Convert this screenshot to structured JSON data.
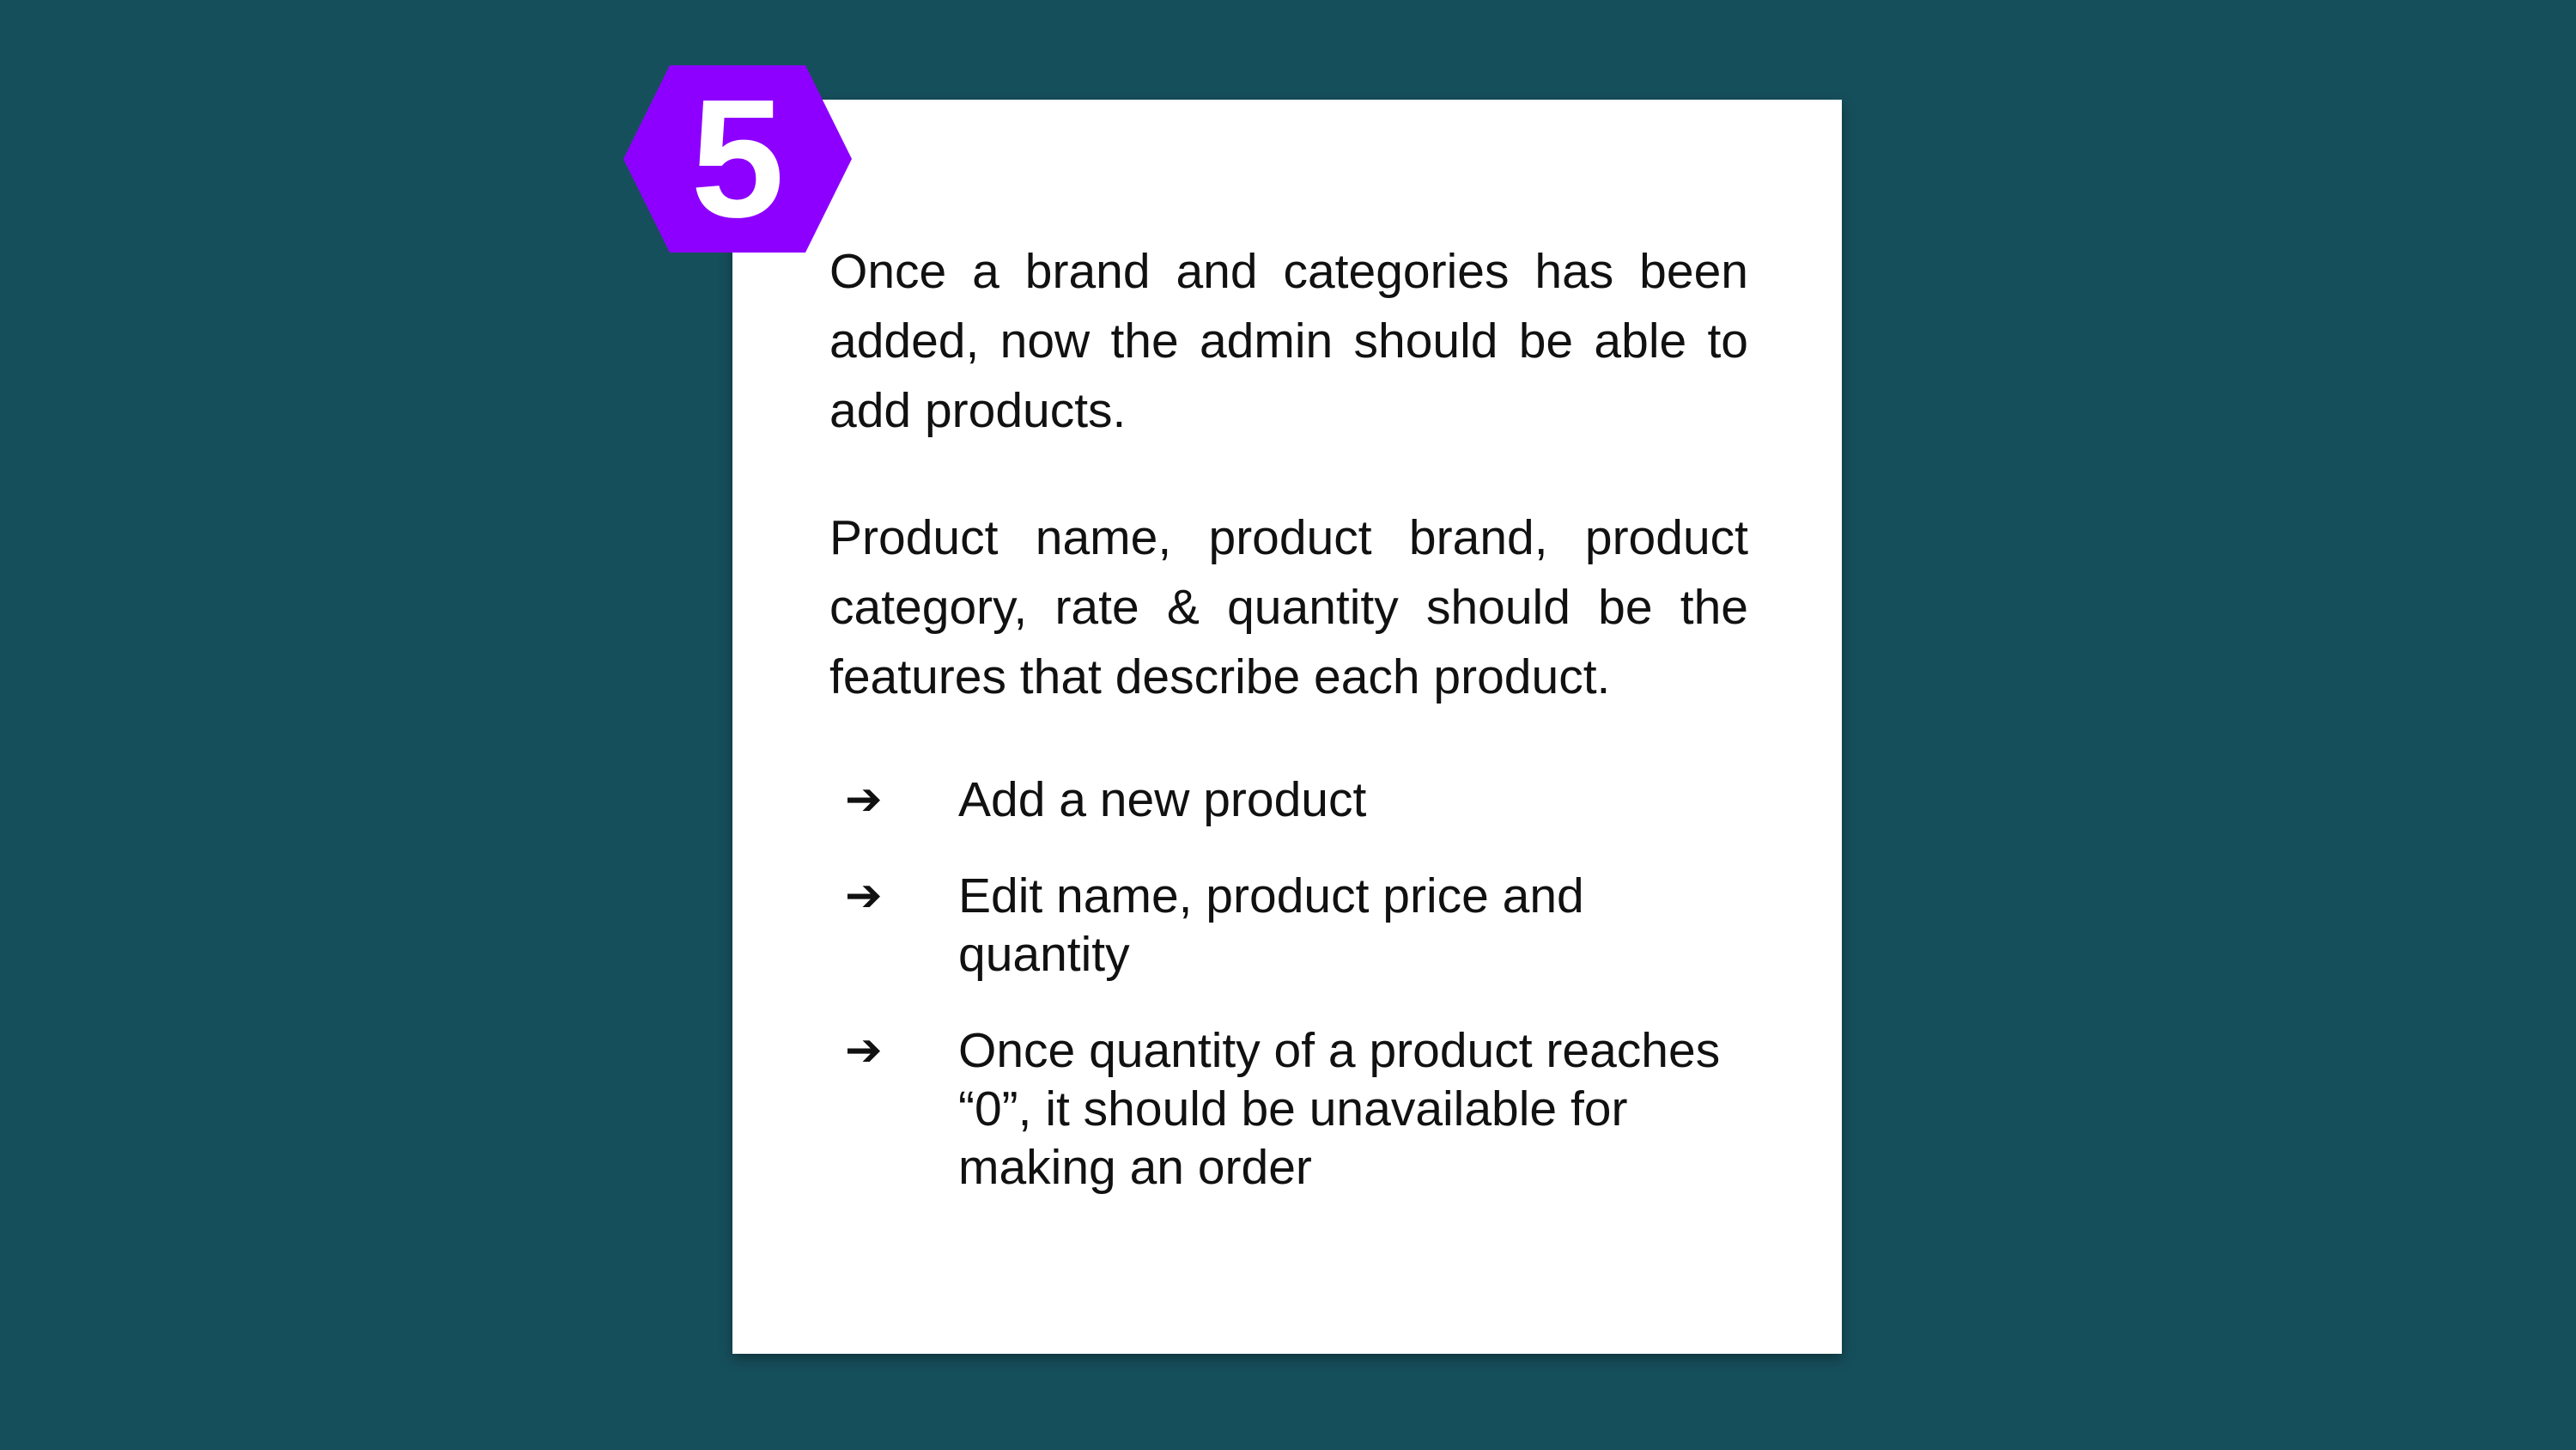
{
  "slide": {
    "background_color": "#164f5c",
    "card_color": "#ffffff",
    "badge": {
      "number": "5",
      "color": "#8d00ff",
      "shape": "hexagon"
    },
    "paragraphs": [
      "Once a brand and categories has been added, now the admin should be able to add products.",
      "Product name, product brand, product category, rate & quantity should be the features that describe each product."
    ],
    "bullet_icon": "➔",
    "bullets": [
      "Add a new product",
      "Edit name, product price and quantity",
      "Once quantity of a product reaches “0”, it should be unavailable for making an order"
    ]
  }
}
